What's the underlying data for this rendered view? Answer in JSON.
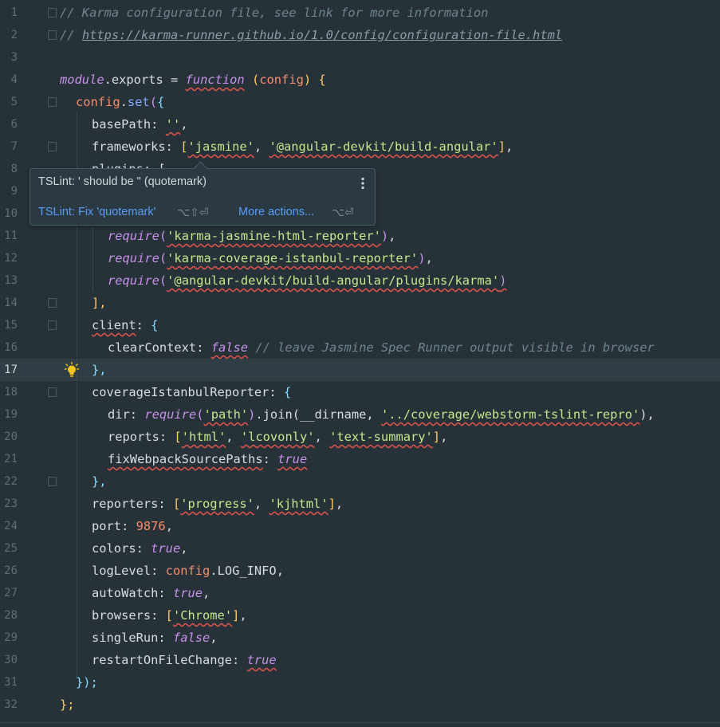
{
  "editor": {
    "line_numbers": [
      "1",
      "2",
      "3",
      "4",
      "5",
      "6",
      "7",
      "8",
      "9",
      "10",
      "11",
      "12",
      "13",
      "14",
      "15",
      "16",
      "17",
      "18",
      "19",
      "20",
      "21",
      "22",
      "23",
      "24",
      "25",
      "26",
      "27",
      "28",
      "29",
      "30",
      "31",
      "32"
    ],
    "current_line": "17",
    "code": {
      "l1": "// Karma configuration file, see link for more information",
      "l2_prefix": "// ",
      "l2_link": "https://karma-runner.github.io/1.0/config/configuration-file.html",
      "l4_module": "module",
      "l4_exports": ".exports = ",
      "l4_function": "function",
      "l4_config": "config",
      "l5_config": "config",
      "l5_set": "set",
      "l6_key": "basePath: ",
      "l6_val": "''",
      "l7_key": "frameworks: ",
      "l7_v1": "'jasmine'",
      "l7_v2": "'@angular-devkit/build-angular'",
      "l8_key": "plugins: [",
      "l11_require": "require",
      "l11_val": "'karma-jasmine-html-reporter'",
      "l12_require": "require",
      "l12_val": "'karma-coverage-istanbul-reporter'",
      "l13_require": "require",
      "l13_val": "'@angular-devkit/build-angular/plugins/karma'",
      "l14": "],",
      "l15_key": "client",
      "l16_key": "clearContext: ",
      "l16_val": "false",
      "l16_comment": "// leave Jasmine Spec Runner output visible in browser",
      "l17": "},",
      "l18_key": "coverageIstanbulReporter: ",
      "l19_key": "dir: ",
      "l19_require": "require",
      "l19_path": "'path'",
      "l19_join": ".join(",
      "l19_dirname": "__dirname, ",
      "l19_val": "'../coverage/webstorm-tslint-repro'",
      "l20_key": "reports: ",
      "l20_v1": "'html'",
      "l20_v2": "'lcovonly'",
      "l20_v3": "'text-summary'",
      "l21_key": "fixWebpackSourcePaths",
      "l21_val": "true",
      "l22": "},",
      "l23_key": "reporters: ",
      "l23_v1": "'progress'",
      "l23_v2": "'kjhtml'",
      "l24_key": "port: ",
      "l24_val": "9876",
      "l25_key": "colors: ",
      "l25_val": "true",
      "l26_key": "logLevel: ",
      "l26_config": "config",
      "l26_prop": ".LOG_INFO",
      "l27_key": "autoWatch: ",
      "l27_val": "true",
      "l28_key": "browsers: ",
      "l28_val": "'Chrome'",
      "l29_key": "singleRun: ",
      "l29_val": "false",
      "l30_key": "restartOnFileChange: ",
      "l30_val": "true",
      "l31": "});",
      "l32": "};"
    }
  },
  "tooltip": {
    "message": "TSLint: ' should be \" (quotemark)",
    "fix_label": "TSLint: Fix 'quotemark'",
    "fix_shortcut": "⌥⇧⏎",
    "more_label": "More actions...",
    "more_shortcut": "⌥⏎",
    "more_icon": "vertical-ellipsis-icon"
  },
  "icons": {
    "intention_bulb": "lightbulb-icon"
  },
  "colors": {
    "background": "#263238",
    "current_line": "#2f3d44",
    "error_underline": "#e05252",
    "link": "#5a9cf5"
  }
}
